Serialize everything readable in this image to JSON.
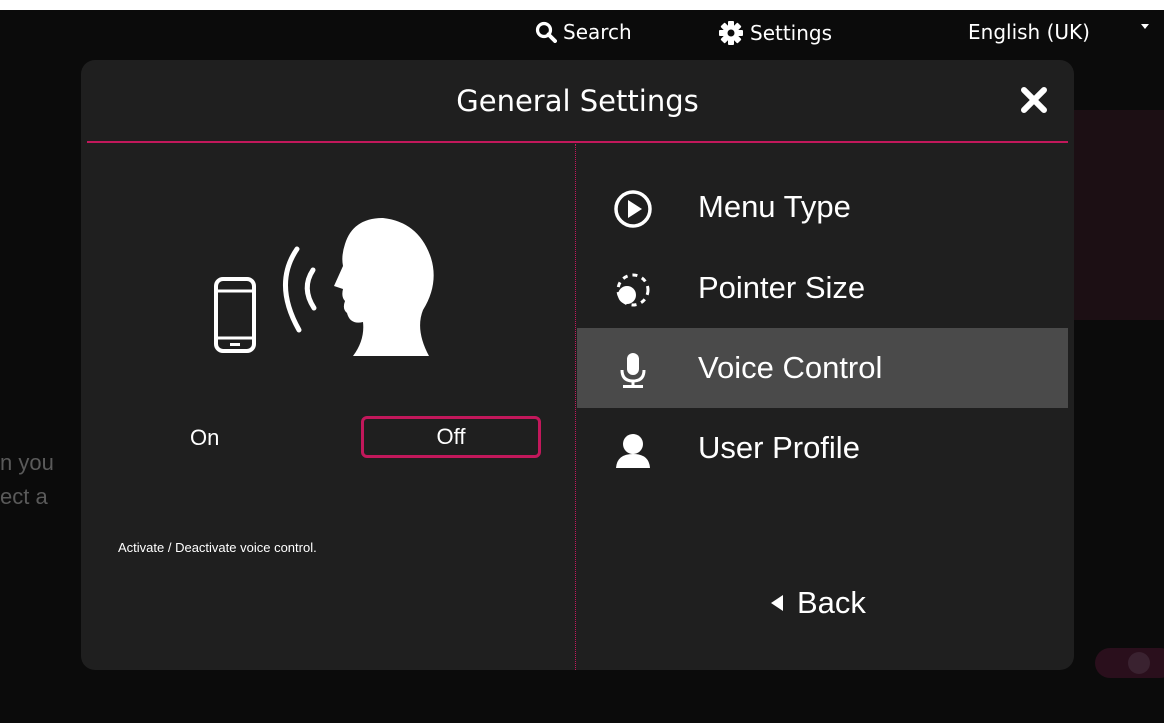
{
  "topnav": {
    "search_label": "Search",
    "settings_label": "Settings",
    "language_label": "English (UK)"
  },
  "background": {
    "line1": "n you",
    "line2": "ect a"
  },
  "modal": {
    "title": "General Settings",
    "voice_toggle": {
      "on_label": "On",
      "off_label": "Off",
      "selected": "Off"
    },
    "description": "Activate / Deactivate voice control.",
    "menu": [
      {
        "label": "Menu Type",
        "icon": "play-circle-icon"
      },
      {
        "label": "Pointer Size",
        "icon": "pointer-size-icon"
      },
      {
        "label": "Voice Control",
        "icon": "microphone-icon",
        "active": true
      },
      {
        "label": "User Profile",
        "icon": "user-icon"
      }
    ],
    "back_label": "Back"
  },
  "colors": {
    "accent": "#c2185b",
    "modal_bg": "#1f1f1f",
    "active_item_bg": "#4a4a4a"
  }
}
